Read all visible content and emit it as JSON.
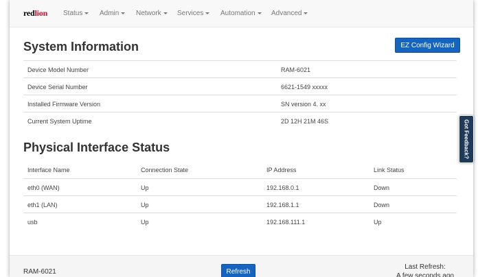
{
  "brand": {
    "part1": "red",
    "part2": "lion"
  },
  "nav": [
    {
      "label": "Status"
    },
    {
      "label": "Admin"
    },
    {
      "label": "Network"
    },
    {
      "label": "Services"
    },
    {
      "label": "Automation"
    },
    {
      "label": "Advanced"
    }
  ],
  "system_info": {
    "title": "System Information",
    "wizard_button": "EZ Config Wizard",
    "rows": [
      {
        "label": "Device Model Number",
        "value": "RAM-6021"
      },
      {
        "label": "Device Serial Number",
        "value": "6621-1549 xxxxx"
      },
      {
        "label": "Installed Firmware Version",
        "value": "SN version 4. xx"
      },
      {
        "label": "Current System Uptime",
        "value": "2D 12H 21M 46S"
      }
    ]
  },
  "interfaces": {
    "title": "Physical Interface Status",
    "headers": [
      "Interface Name",
      "Connection State",
      "IP Address",
      "Link Status"
    ],
    "rows": [
      [
        "eth0 (WAN)",
        "Up",
        "192.168.0.1",
        "Down"
      ],
      [
        "eth1 (LAN)",
        "Up",
        "192.168.1.1",
        "Down"
      ],
      [
        "usb",
        "Up",
        "192.168.111.1",
        "Up"
      ]
    ]
  },
  "feedback": "Got Feedback?",
  "footer": {
    "model": "RAM-6021",
    "refresh_button": "Refresh",
    "last_refresh_label": "Last Refresh:",
    "last_refresh_value": "A few seconds ago"
  },
  "colors": {
    "primary_button": "#1565c0",
    "feedback_tab": "#1f3b5b",
    "brand_red": "#c8102e"
  }
}
